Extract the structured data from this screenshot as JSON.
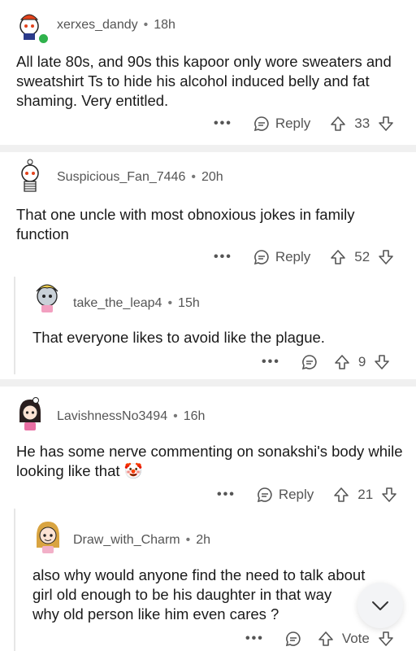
{
  "comments": [
    {
      "username": "xerxes_dandy",
      "age": "18h",
      "body": "All late 80s, and 90s this kapoor only wore sweaters and sweatshirt Ts to hide his alcohol induced belly and fat shaming. Very entitled.",
      "reply_label": "Reply",
      "votes": "33",
      "avatar_icon": "snoo-red-hat-avatar",
      "online": true
    },
    {
      "username": "Suspicious_Fan_7446",
      "age": "20h",
      "body": "That one uncle with most obnoxious jokes in family function",
      "reply_label": "Reply",
      "votes": "52",
      "avatar_icon": "snoo-skeleton-avatar"
    },
    {
      "username": "take_the_leap4",
      "age": "15h",
      "body": "That everyone likes to avoid like the plague.",
      "votes": "9",
      "avatar_icon": "snoo-blonde-avatar"
    },
    {
      "username": "LavishnessNo3494",
      "age": "16h",
      "body": "He has some nerve commenting on sonakshi's body while looking like that",
      "emoji": "🤡",
      "reply_label": "Reply",
      "votes": "21",
      "avatar_icon": "snoo-dark-hair-avatar"
    },
    {
      "username": "Draw_with_Charm",
      "age": "2h",
      "body_lines": [
        "also why would anyone find the need to talk about",
        "girl old enough to be his daughter in that way",
        "why old  person like him even cares ?"
      ],
      "votes": "Vote",
      "avatar_icon": "snoo-brown-hair-avatar"
    }
  ],
  "more_label": "•••"
}
